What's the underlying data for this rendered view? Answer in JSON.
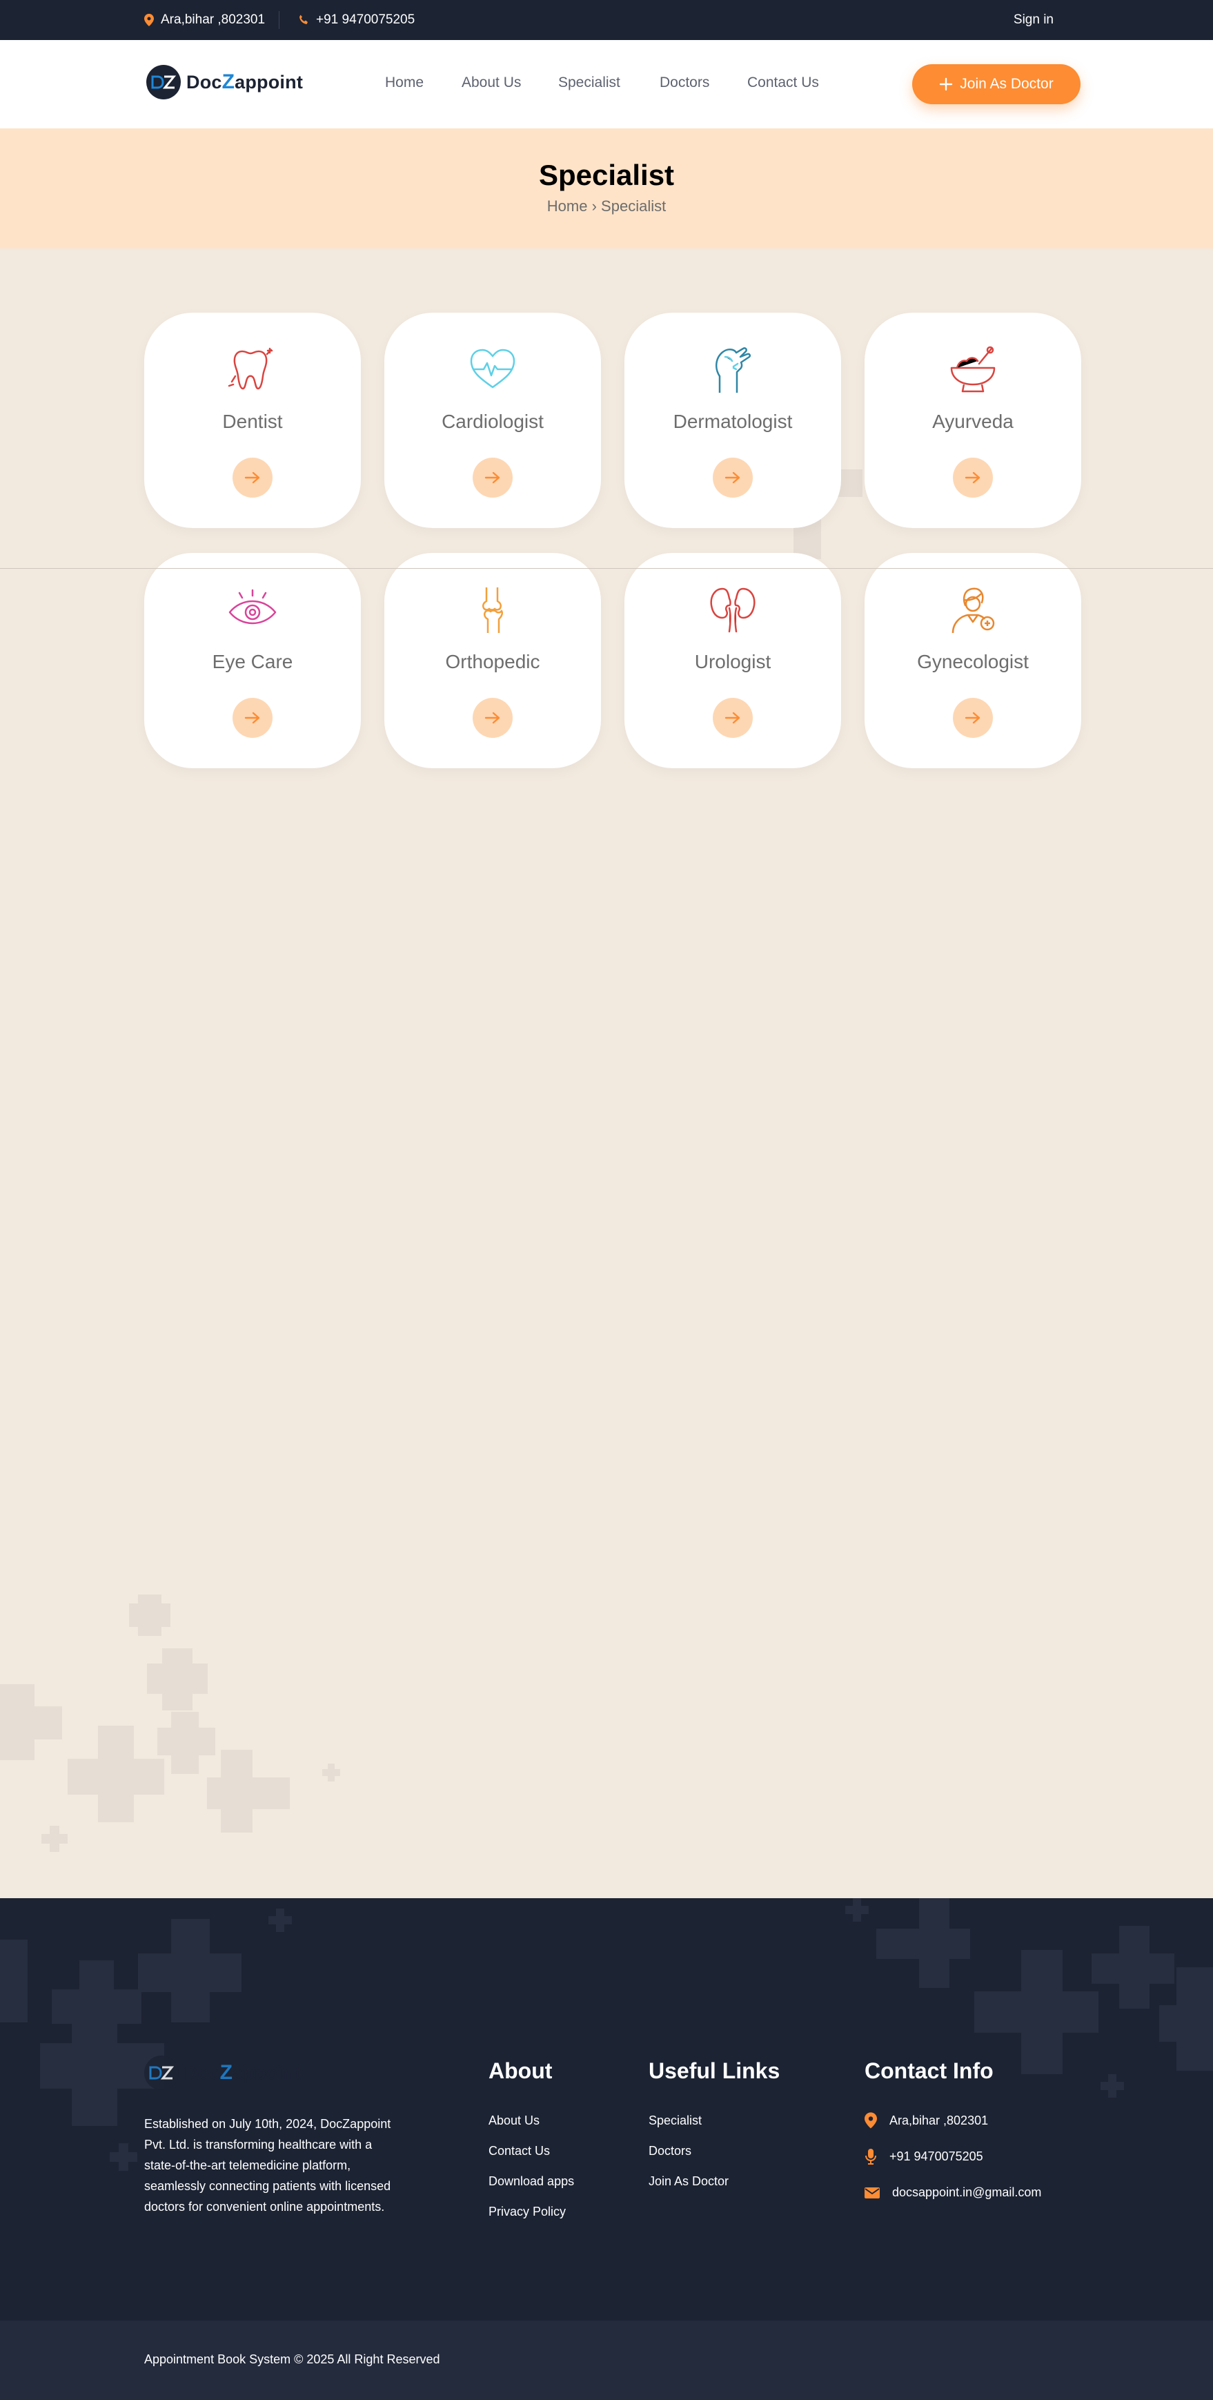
{
  "topbar": {
    "address": "Ara,bihar ,802301",
    "phone": "+91 9470075205",
    "signin": "Sign in"
  },
  "header": {
    "logo_text_a": "Doc",
    "logo_text_z": "Z",
    "logo_text_b": "appoint",
    "nav": [
      "Home",
      "About Us",
      "Specialist",
      "Doctors",
      "Contact Us"
    ],
    "join_button": "Join As Doctor"
  },
  "banner": {
    "title": "Specialist",
    "crumb_home": "Home",
    "crumb_sep": "›",
    "crumb_current": "Specialist"
  },
  "specialists": [
    {
      "name": "Dentist",
      "icon": "tooth-icon",
      "color": "#d9443f"
    },
    {
      "name": "Cardiologist",
      "icon": "heart-pulse-icon",
      "color": "#5ed0e6"
    },
    {
      "name": "Dermatologist",
      "icon": "skin-hand-icon",
      "color": "#2f86a6"
    },
    {
      "name": "Ayurveda",
      "icon": "mortar-bowl-icon",
      "color": "#d9443f"
    },
    {
      "name": "Eye Care",
      "icon": "eye-icon",
      "color": "#d9449a"
    },
    {
      "name": "Orthopedic",
      "icon": "knee-joint-icon",
      "color": "#f2a03d"
    },
    {
      "name": "Urologist",
      "icon": "kidney-icon",
      "color": "#d9443f"
    },
    {
      "name": "Gynecologist",
      "icon": "female-doctor-icon",
      "color": "#e8872f"
    }
  ],
  "footer": {
    "about_text": "Established on July 10th, 2024, DocZappoint Pvt. Ltd. is transforming healthcare with a state-of-the-art telemedicine platform, seamlessly connecting patients with licensed doctors for convenient online appointments.",
    "about_title": "About",
    "about_links": [
      "About Us",
      "Contact Us",
      "Download apps",
      "Privacy Policy"
    ],
    "useful_title": "Useful Links",
    "useful_links": [
      "Specialist",
      "Doctors",
      "Join As Doctor"
    ],
    "contact_title": "Contact Info",
    "contact": {
      "address": "Ara,bihar ,802301",
      "phone": "+91 9470075205",
      "email": "docsappoint.in@gmail.com"
    },
    "copyright": "Appointment Book System © 2025 All Right Reserved"
  },
  "colors": {
    "accent": "#fd8c33",
    "dark": "#1c2333",
    "banner": "#fee3c8",
    "page_bg": "#f2e9df"
  }
}
